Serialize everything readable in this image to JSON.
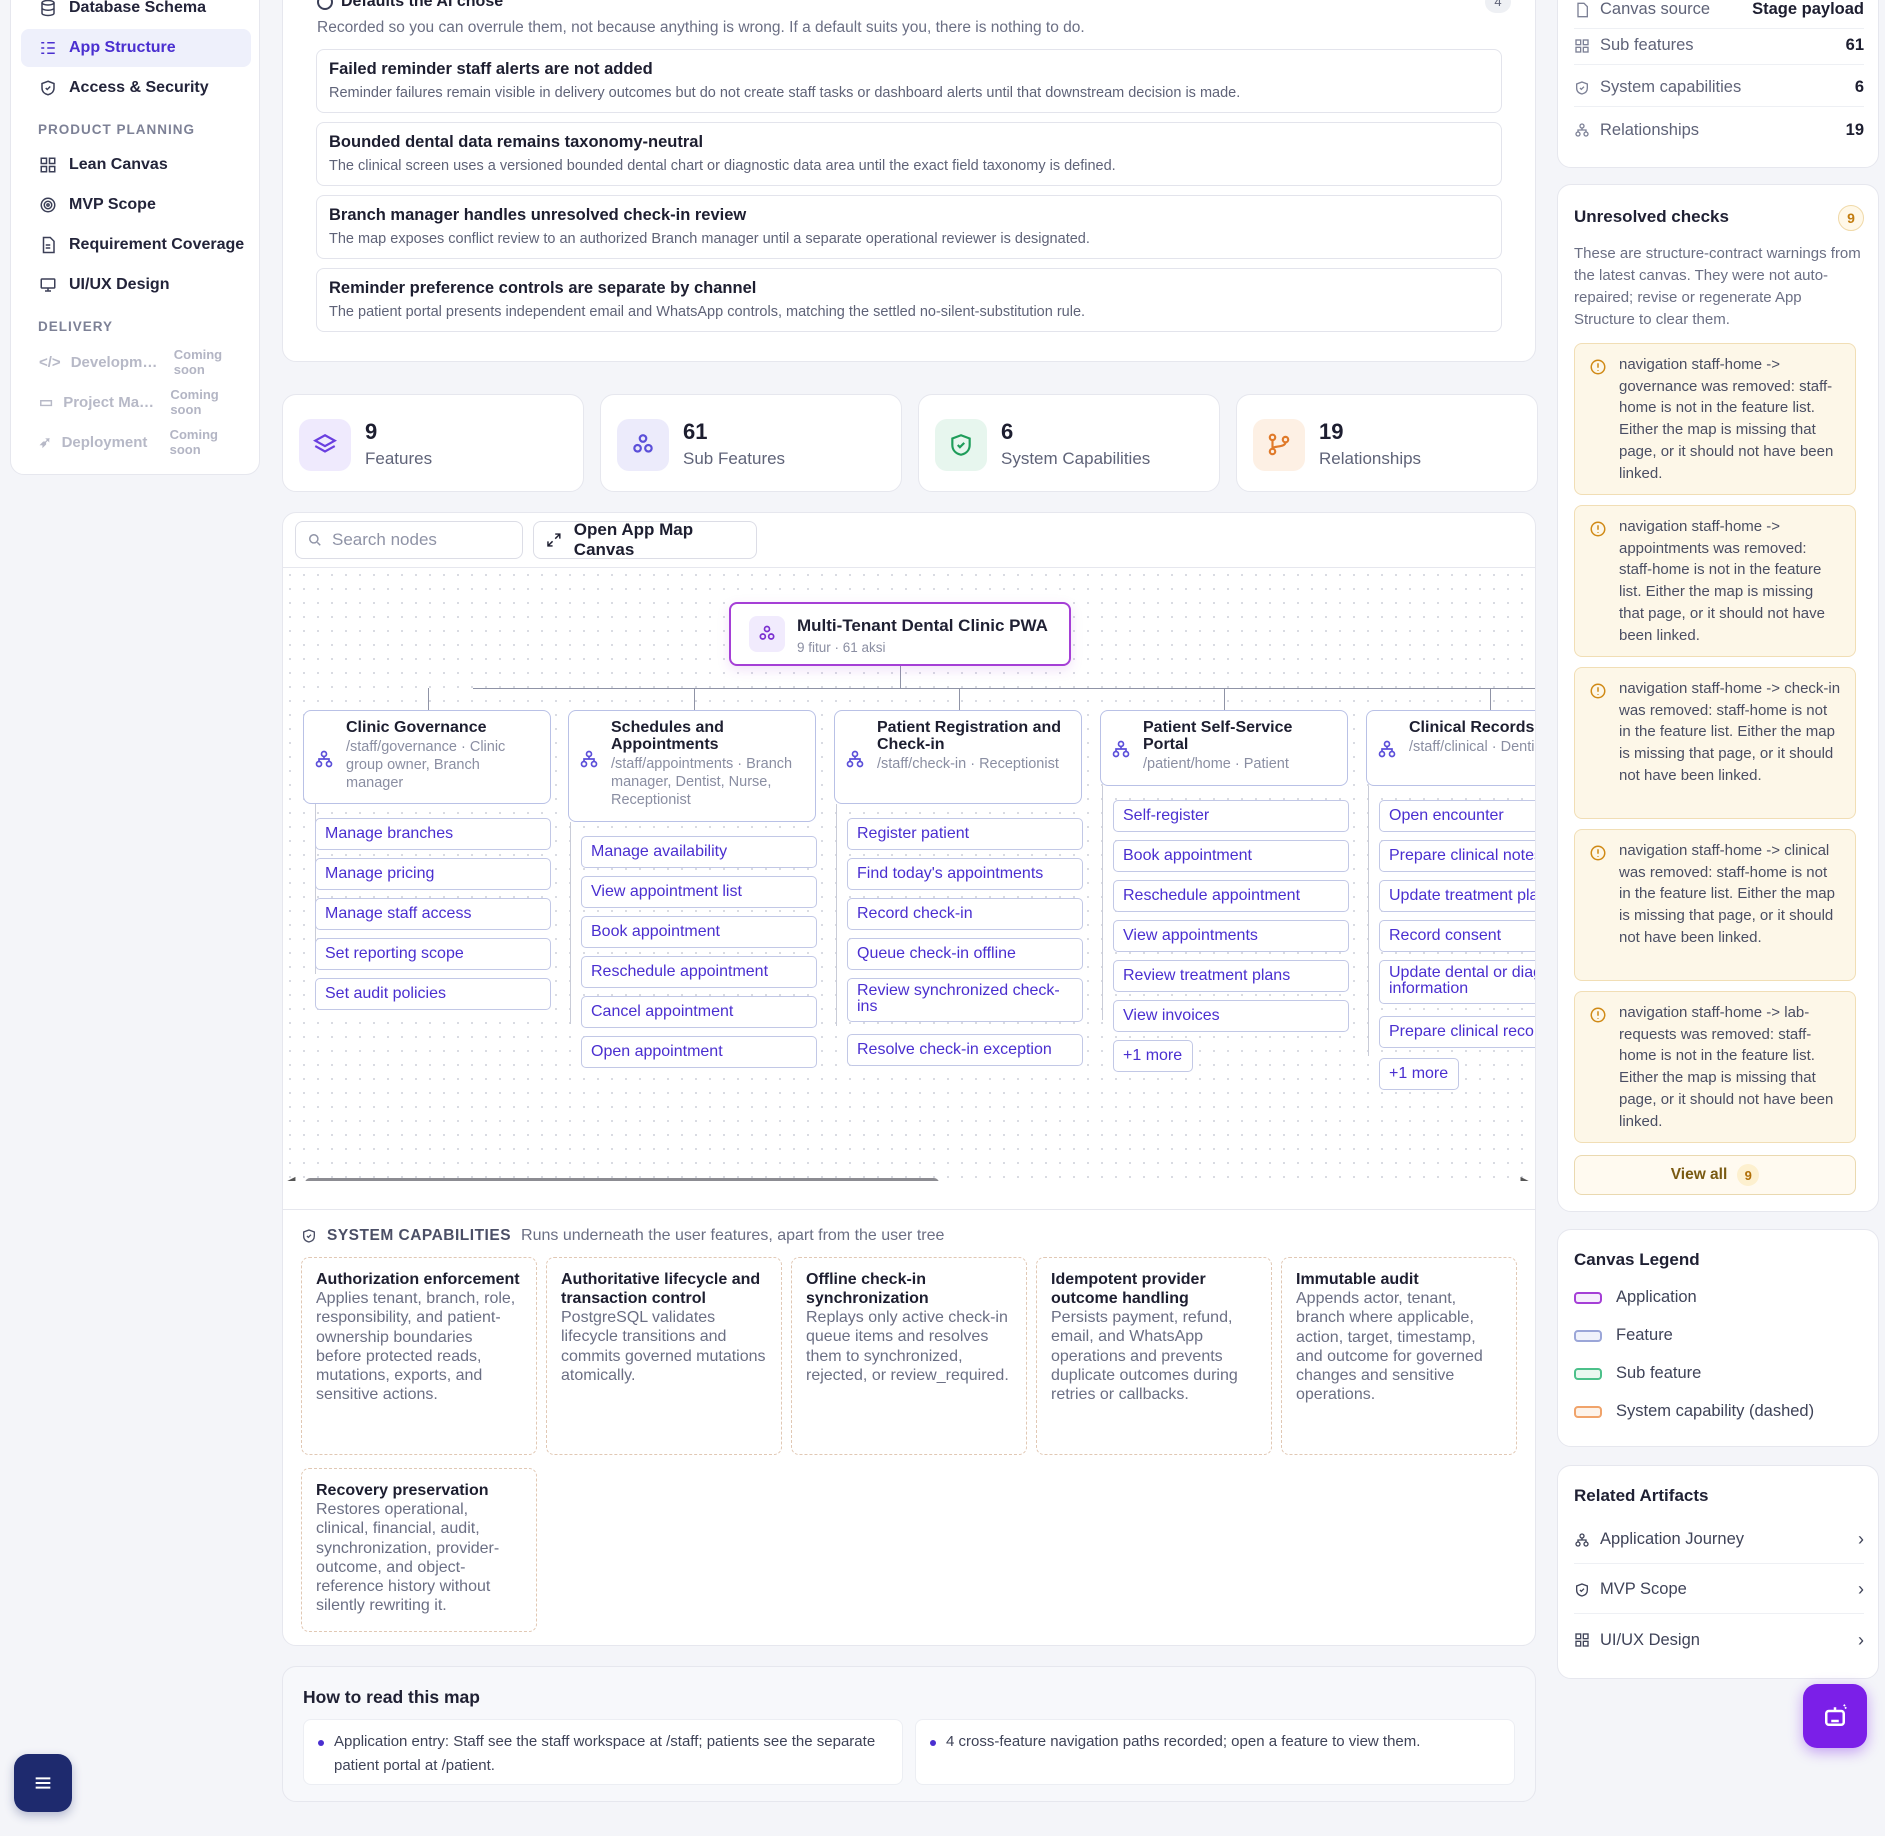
{
  "sidebar": {
    "items_top": [
      {
        "label": "Database Schema",
        "icon": "database-icon"
      },
      {
        "label": "App Structure",
        "icon": "list-tree-icon",
        "active": true
      },
      {
        "label": "Access & Security",
        "icon": "shield-icon"
      }
    ],
    "section_planning": "PRODUCT PLANNING",
    "items_planning": [
      {
        "label": "Lean Canvas",
        "icon": "grid-icon"
      },
      {
        "label": "MVP Scope",
        "icon": "target-icon"
      },
      {
        "label": "Requirement Coverage",
        "icon": "document-icon"
      },
      {
        "label": "UI/UX Design",
        "icon": "monitor-icon"
      }
    ],
    "section_delivery": "DELIVERY",
    "items_delivery": [
      {
        "label": "Development",
        "badge": "Coming soon"
      },
      {
        "label": "Project Management",
        "badge": "Coming soon"
      },
      {
        "label": "Deployment",
        "badge": "Coming soon"
      }
    ]
  },
  "defaults": {
    "title": "Defaults the AI chose",
    "count": "4",
    "subtitle": "Recorded so you can overrule them, not because anything is wrong. If a default suits you, there is nothing to do.",
    "items": [
      {
        "title": "Failed reminder staff alerts are not added",
        "desc": "Reminder failures remain visible in delivery outcomes but do not create staff tasks or dashboard alerts until that downstream decision is made."
      },
      {
        "title": "Bounded dental data remains taxonomy-neutral",
        "desc": "The clinical screen uses a versioned bounded dental chart or diagnostic data area until the exact field taxonomy is defined."
      },
      {
        "title": "Branch manager handles unresolved check-in review",
        "desc": "The map exposes conflict review to an authorized Branch manager until a separate operational reviewer is designated."
      },
      {
        "title": "Reminder preference controls are separate by channel",
        "desc": "The patient portal presents independent email and WhatsApp controls, matching the settled no-silent-substitution rule."
      }
    ]
  },
  "stats": [
    {
      "value": "9",
      "label": "Features",
      "color": "#6a3fe0"
    },
    {
      "value": "61",
      "label": "Sub Features",
      "color": "#5b4fd9"
    },
    {
      "value": "6",
      "label": "System Capabilities",
      "color": "#1f9d5a"
    },
    {
      "value": "19",
      "label": "Relationships",
      "color": "#e07a2a"
    }
  ],
  "map": {
    "search_placeholder": "Search nodes",
    "open_button": "Open App Map Canvas",
    "root": {
      "title": "Multi-Tenant Dental Clinic PWA",
      "subtitle": "9 fitur · 61 aksi"
    },
    "features": [
      {
        "title": "Clinic Governance",
        "meta": "/staff/governance · Clinic group owner, Branch manager",
        "subs": [
          "Manage branches",
          "Manage pricing",
          "Manage staff access",
          "Set reporting scope",
          "Set audit policies"
        ]
      },
      {
        "title": "Schedules and Appointments",
        "meta": "/staff/appointments · Branch manager, Dentist, Nurse, Receptionist",
        "subs": [
          "Manage availability",
          "View appointment list",
          "Book appointment",
          "Reschedule appointment",
          "Cancel appointment",
          "Open appointment"
        ]
      },
      {
        "title": "Patient Registration and Check-in",
        "meta": "/staff/check-in · Receptionist",
        "subs": [
          "Register patient",
          "Find today's appointments",
          "Record check-in",
          "Queue check-in offline",
          "Review synchronized check-ins",
          "Resolve check-in exception"
        ]
      },
      {
        "title": "Patient Self-Service Portal",
        "meta": "/patient/home · Patient",
        "subs": [
          "Self-register",
          "Book appointment",
          "Reschedule appointment",
          "View appointments",
          "Review treatment plans",
          "View invoices"
        ],
        "more": "+1 more"
      },
      {
        "title": "Clinical Records",
        "meta": "/staff/clinical · Dentist, Nurse",
        "subs": [
          "Open encounter",
          "Prepare clinical notes",
          "Update treatment plan",
          "Record consent",
          "Update dental or diagnostic information",
          "Prepare clinical records"
        ],
        "more": "+1 more"
      }
    ]
  },
  "system_capabilities": {
    "heading": "SYSTEM CAPABILITIES",
    "desc": "Runs underneath the user features, apart from the user tree",
    "items": [
      {
        "title": "Authorization enforcement",
        "desc": "Applies tenant, branch, role, responsibility, and patient-ownership boundaries before protected reads, mutations, exports, and sensitive actions."
      },
      {
        "title": "Authoritative lifecycle and transaction control",
        "desc": "PostgreSQL validates lifecycle transitions and commits governed mutations atomically."
      },
      {
        "title": "Offline check-in synchronization",
        "desc": "Replays only active check-in queue items and resolves them to synchronized, rejected, or review_required."
      },
      {
        "title": "Idempotent provider outcome handling",
        "desc": "Persists payment, refund, email, and WhatsApp operations and prevents duplicate outcomes during retries or callbacks."
      },
      {
        "title": "Immutable audit",
        "desc": "Appends actor, tenant, branch where applicable, action, target, timestamp, and outcome for governed changes and sensitive operations."
      },
      {
        "title": "Recovery preservation",
        "desc": "Restores operational, clinical, financial, audit, synchronization, provider-outcome, and object-reference history without silently rewriting it."
      }
    ]
  },
  "howto": {
    "title": "How to read this map",
    "items": [
      "Application entry: Staff see the staff workspace at /staff; patients see the separate patient portal at /patient.",
      "4 cross-feature navigation paths recorded; open a feature to view them."
    ]
  },
  "canvas_source": {
    "rows": [
      {
        "label": "Canvas source",
        "value": "Stage payload"
      },
      {
        "label": "Sub features",
        "value": "61"
      },
      {
        "label": "System capabilities",
        "value": "6"
      },
      {
        "label": "Relationships",
        "value": "19"
      }
    ]
  },
  "unresolved": {
    "title": "Unresolved checks",
    "count": "9",
    "desc": "These are structure-contract warnings from the latest canvas. They were not auto-repaired; revise or regenerate App Structure to clear them.",
    "items": [
      "navigation staff-home -> governance was removed: staff-home is not in the feature list. Either the map is missing that page, or it should not have been linked.",
      "navigation staff-home -> appointments was removed: staff-home is not in the feature list. Either the map is missing that page, or it should not have been linked.",
      "navigation staff-home -> check-in was removed: staff-home is not in the feature list. Either the map is missing that page, or it should not have been linked.",
      "navigation staff-home -> clinical was removed: staff-home is not in the feature list. Either the map is missing that page, or it should not have been linked.",
      "navigation staff-home -> lab-requests was removed: staff-home is not in the feature list. Either the map is missing that page, or it should not have been linked."
    ],
    "view_all": "View all",
    "view_all_count": "9"
  },
  "legend": {
    "title": "Canvas Legend",
    "items": [
      {
        "label": "Application",
        "color": "#a53fd6"
      },
      {
        "label": "Feature",
        "color": "#9ba6d8"
      },
      {
        "label": "Sub feature",
        "color": "#4cc08a"
      },
      {
        "label": "System capability (dashed)",
        "color": "#f0a36a"
      }
    ]
  },
  "related": {
    "title": "Related Artifacts",
    "items": [
      {
        "label": "Application Journey",
        "icon": "network-icon"
      },
      {
        "label": "MVP Scope",
        "icon": "shield-check-icon"
      },
      {
        "label": "UI/UX Design",
        "icon": "grid-icon"
      }
    ]
  }
}
